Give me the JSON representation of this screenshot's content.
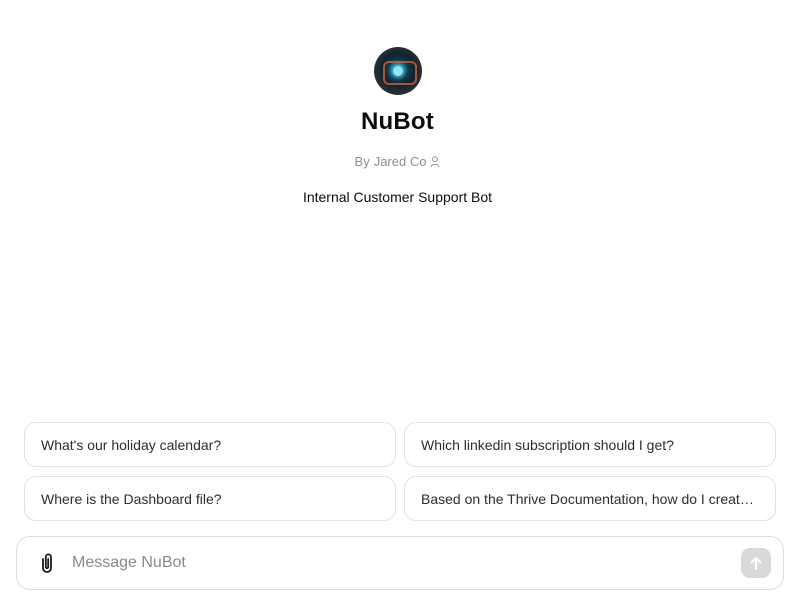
{
  "bot": {
    "name": "NuBot",
    "author_prefix": "By",
    "author": "Jared Co",
    "description": "Internal Customer Support Bot"
  },
  "starters": [
    "What's our holiday calendar?",
    "Which linkedin subscription should I get?",
    "Where is the Dashboard file?",
    "Based on the Thrive Documentation, how do I create ..."
  ],
  "composer": {
    "placeholder": "Message NuBot"
  },
  "icons": {
    "avatar": "bot-avatar-image",
    "author": "person-icon",
    "attach": "paperclip-icon",
    "send": "arrow-up-icon"
  }
}
